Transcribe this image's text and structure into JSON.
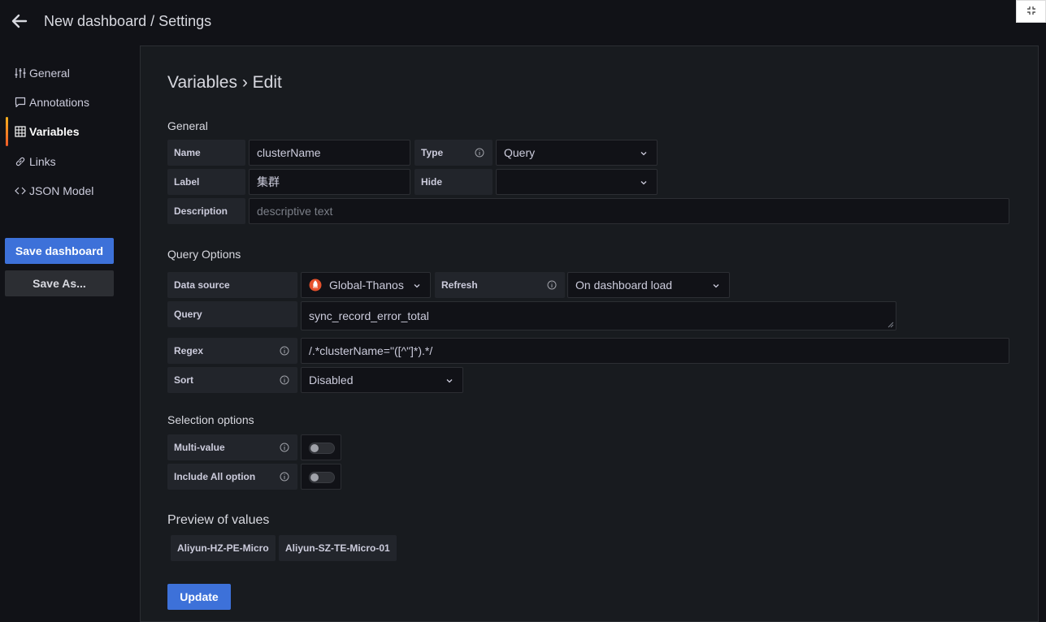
{
  "header": {
    "title": "New dashboard / Settings"
  },
  "sidebar": {
    "items": [
      {
        "label": "General",
        "icon": "sliders-icon"
      },
      {
        "label": "Annotations",
        "icon": "comment-icon"
      },
      {
        "label": "Variables",
        "icon": "calculator-icon",
        "active": true
      },
      {
        "label": "Links",
        "icon": "link-icon"
      },
      {
        "label": "JSON Model",
        "icon": "code-icon"
      }
    ],
    "save_label": "Save dashboard",
    "save_as_label": "Save As..."
  },
  "main": {
    "heading": "Variables › Edit",
    "general": {
      "section_title": "General",
      "name_label": "Name",
      "name_value": "clusterName",
      "type_label": "Type",
      "type_value": "Query",
      "label_label": "Label",
      "label_value": "集群",
      "hide_label": "Hide",
      "hide_value": "",
      "description_label": "Description",
      "description_placeholder": "descriptive text"
    },
    "query_options": {
      "section_title": "Query Options",
      "datasource_label": "Data source",
      "datasource_value": "Global-Thanos",
      "refresh_label": "Refresh",
      "refresh_value": "On dashboard load",
      "query_label": "Query",
      "query_value": "sync_record_error_total",
      "regex_label": "Regex",
      "regex_value": "/.*clusterName=\"([^\"]*).*/",
      "sort_label": "Sort",
      "sort_value": "Disabled"
    },
    "selection": {
      "section_title": "Selection options",
      "multi_label": "Multi-value",
      "multi_on": false,
      "include_all_label": "Include All option",
      "include_all_on": false
    },
    "preview": {
      "title": "Preview of values",
      "values": [
        "Aliyun-HZ-PE-Micro",
        "Aliyun-SZ-TE-Micro-01"
      ]
    },
    "update_label": "Update"
  },
  "colors": {
    "accent": "#3d71d9",
    "background": "#111217",
    "panel": "#181b1f",
    "active_bar": "#f7b01e"
  }
}
